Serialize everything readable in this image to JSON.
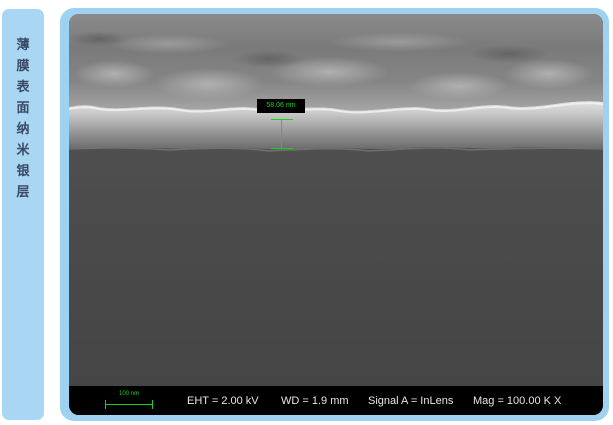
{
  "side_label": {
    "chars": [
      "薄",
      "膜",
      "表",
      "面",
      "纳",
      "米",
      "银",
      "层"
    ]
  },
  "measurement": {
    "label": "58.06 nm"
  },
  "scale_bar": {
    "label": "100 nm"
  },
  "info_bar": {
    "eht": "EHT =  2.00 kV",
    "wd": "WD =  1.9 mm",
    "signal": "Signal A = InLens",
    "mag": "Mag =  100.00 K X"
  },
  "colors": {
    "side_panel": "#a9d7f3",
    "frame": "#9fd1f1",
    "annotation_green": "#18d318",
    "info_bar_bg": "#000000"
  }
}
